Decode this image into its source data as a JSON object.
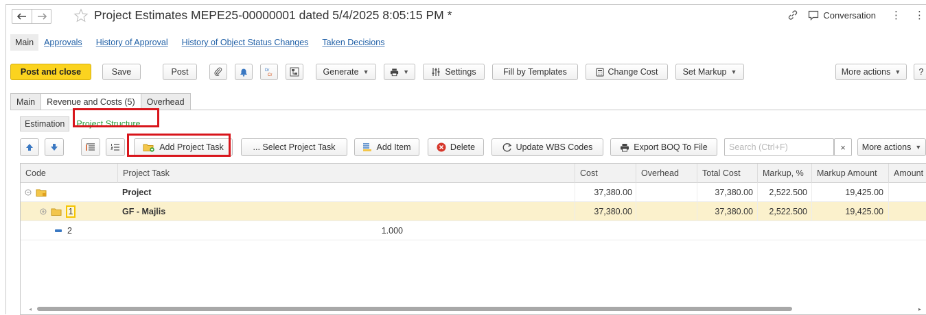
{
  "window": {
    "title": "Project Estimates MEPE25-00000001 dated 5/4/2025 8:05:15 PM *",
    "conversation_label": "Conversation"
  },
  "nav_links": {
    "current": "Main",
    "links": [
      "Approvals",
      "History of Approval",
      "History of Object Status Changes",
      "Taken Decisions"
    ]
  },
  "command_bar": {
    "post_and_close": "Post and close",
    "save": "Save",
    "post": "Post",
    "drcr": "Dr\nCr",
    "generate": "Generate",
    "settings": "Settings",
    "fill_by_templates": "Fill by Templates",
    "change_cost": "Change Cost",
    "set_markup": "Set Markup",
    "more_actions": "More actions",
    "help": "?"
  },
  "tabs": [
    "Main",
    "Revenue and Costs (5)",
    "Overhead"
  ],
  "active_tab": "Revenue and Costs (5)",
  "structure_tabs": {
    "estimation": "Estimation",
    "project_structure": "Project Structure"
  },
  "table_toolbar": {
    "add_project_task": "Add Project Task",
    "select_project_task": "... Select Project Task",
    "add_item": "Add Item",
    "delete": "Delete",
    "update_wbs": "Update WBS Codes",
    "export_boq": "Export BOQ To File",
    "search_placeholder": "Search (Ctrl+F)",
    "clear": "×",
    "more_actions": "More actions"
  },
  "grid": {
    "columns": [
      "Code",
      "Project Task",
      "Cost",
      "Overhead",
      "Total Cost",
      "Markup, %",
      "Markup Amount",
      "Amount"
    ],
    "rows": [
      {
        "code": "",
        "task": "Project",
        "qty": "",
        "cost": "37,380.00",
        "overhead": "",
        "total_cost": "37,380.00",
        "markup_pct": "2,522.500",
        "markup_amount": "19,425.00"
      },
      {
        "code": "1",
        "task": "GF - Majlis",
        "qty": "",
        "cost": "37,380.00",
        "overhead": "",
        "total_cost": "37,380.00",
        "markup_pct": "2,522.500",
        "markup_amount": "19,425.00"
      },
      {
        "code": "2",
        "task": "",
        "qty": "1.000",
        "cost": "",
        "overhead": "",
        "total_cost": "",
        "markup_pct": "",
        "markup_amount": ""
      }
    ]
  },
  "colors": {
    "primary_button": "#fbd31f",
    "highlight_box": "#d8151b",
    "link": "#1f5fa6",
    "active_structure_tab": "#2a9c3a",
    "selected_row": "#fbf1cc"
  }
}
